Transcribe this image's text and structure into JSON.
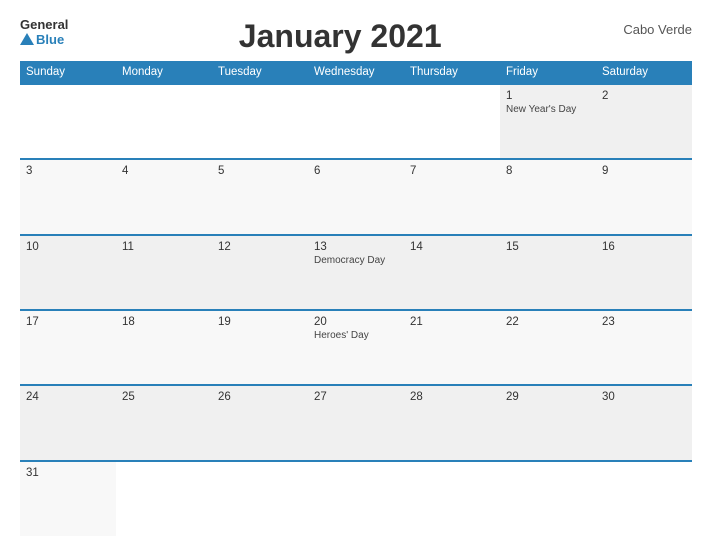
{
  "header": {
    "logo_general": "General",
    "logo_blue": "Blue",
    "title": "January 2021",
    "country": "Cabo Verde"
  },
  "weekdays": [
    "Sunday",
    "Monday",
    "Tuesday",
    "Wednesday",
    "Thursday",
    "Friday",
    "Saturday"
  ],
  "weeks": [
    [
      {
        "day": "",
        "holiday": ""
      },
      {
        "day": "",
        "holiday": ""
      },
      {
        "day": "",
        "holiday": ""
      },
      {
        "day": "",
        "holiday": ""
      },
      {
        "day": "",
        "holiday": ""
      },
      {
        "day": "1",
        "holiday": "New Year's Day"
      },
      {
        "day": "2",
        "holiday": ""
      }
    ],
    [
      {
        "day": "3",
        "holiday": ""
      },
      {
        "day": "4",
        "holiday": ""
      },
      {
        "day": "5",
        "holiday": ""
      },
      {
        "day": "6",
        "holiday": ""
      },
      {
        "day": "7",
        "holiday": ""
      },
      {
        "day": "8",
        "holiday": ""
      },
      {
        "day": "9",
        "holiday": ""
      }
    ],
    [
      {
        "day": "10",
        "holiday": ""
      },
      {
        "day": "11",
        "holiday": ""
      },
      {
        "day": "12",
        "holiday": ""
      },
      {
        "day": "13",
        "holiday": "Democracy Day"
      },
      {
        "day": "14",
        "holiday": ""
      },
      {
        "day": "15",
        "holiday": ""
      },
      {
        "day": "16",
        "holiday": ""
      }
    ],
    [
      {
        "day": "17",
        "holiday": ""
      },
      {
        "day": "18",
        "holiday": ""
      },
      {
        "day": "19",
        "holiday": ""
      },
      {
        "day": "20",
        "holiday": "Heroes' Day"
      },
      {
        "day": "21",
        "holiday": ""
      },
      {
        "day": "22",
        "holiday": ""
      },
      {
        "day": "23",
        "holiday": ""
      }
    ],
    [
      {
        "day": "24",
        "holiday": ""
      },
      {
        "day": "25",
        "holiday": ""
      },
      {
        "day": "26",
        "holiday": ""
      },
      {
        "day": "27",
        "holiday": ""
      },
      {
        "day": "28",
        "holiday": ""
      },
      {
        "day": "29",
        "holiday": ""
      },
      {
        "day": "30",
        "holiday": ""
      }
    ],
    [
      {
        "day": "31",
        "holiday": ""
      },
      {
        "day": "",
        "holiday": ""
      },
      {
        "day": "",
        "holiday": ""
      },
      {
        "day": "",
        "holiday": ""
      },
      {
        "day": "",
        "holiday": ""
      },
      {
        "day": "",
        "holiday": ""
      },
      {
        "day": "",
        "holiday": ""
      }
    ]
  ]
}
